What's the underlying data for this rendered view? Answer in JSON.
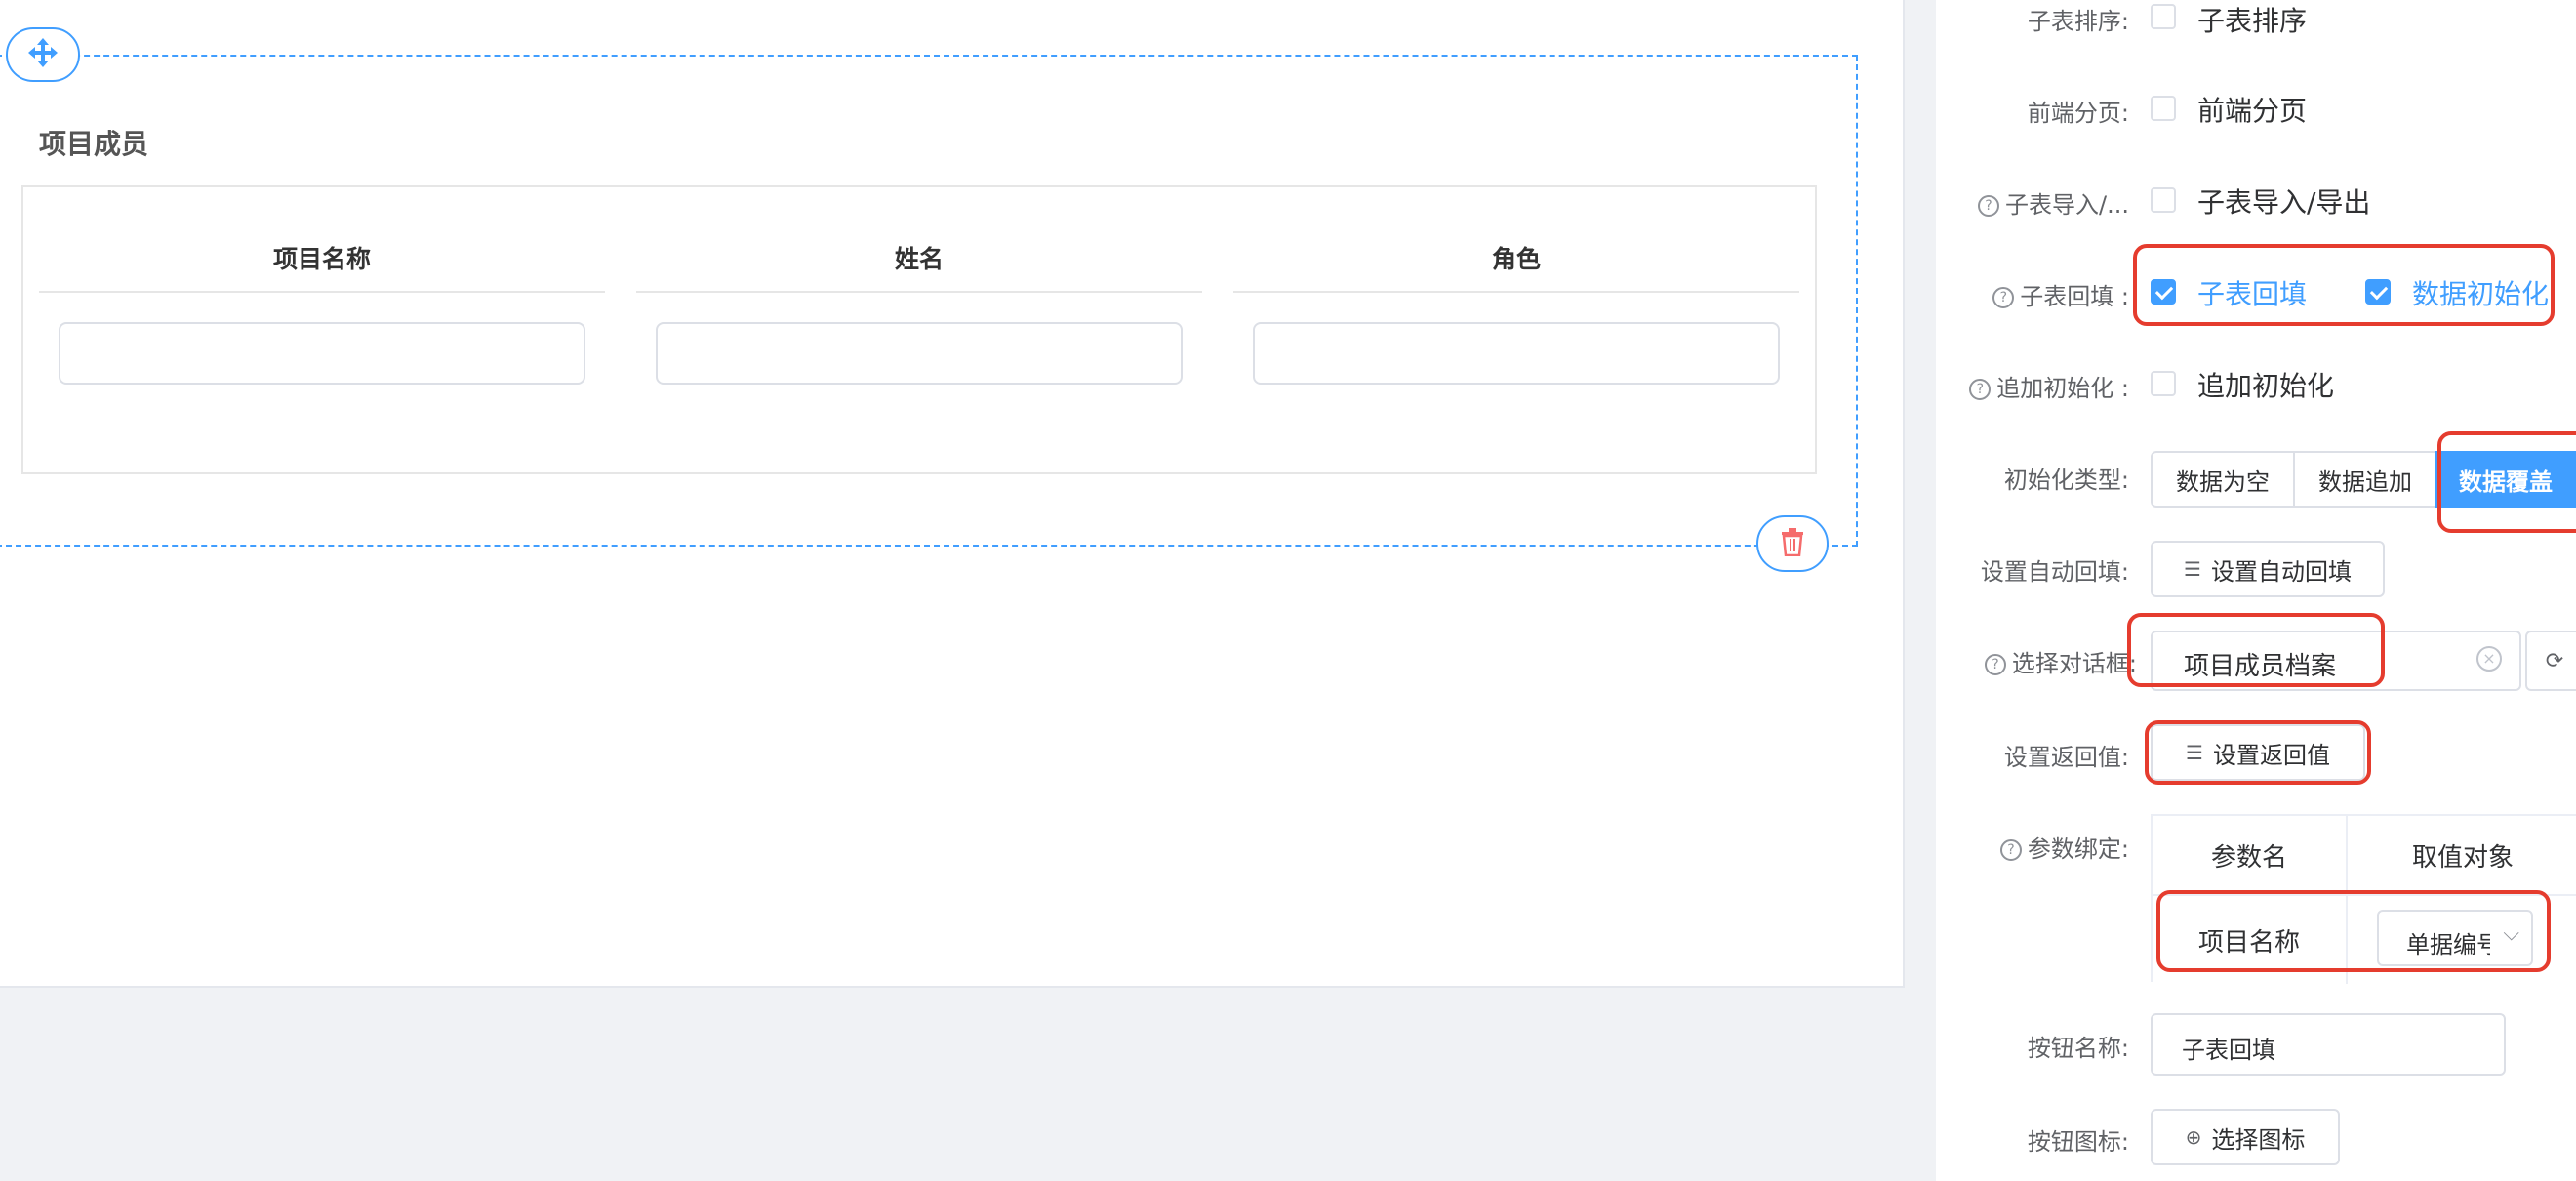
{
  "canvas": {
    "section_title": "项目成员",
    "columns": [
      "项目名称",
      "姓名",
      "角色"
    ]
  },
  "props": {
    "sort": {
      "label": "子表排序:",
      "option": "子表排序",
      "checked": false
    },
    "paging": {
      "label": "前端分页:",
      "option": "前端分页",
      "checked": false
    },
    "import_export": {
      "label": "子表导入/...",
      "option": "子表导入/导出",
      "checked": false
    },
    "backfill": {
      "label": "子表回填 :",
      "option1": "子表回填",
      "option2": "数据初始化",
      "checked1": true,
      "checked2": true
    },
    "append_init": {
      "label": "追加初始化 :",
      "option": "追加初始化",
      "checked": false
    },
    "init_type": {
      "label": "初始化类型:",
      "options": [
        "数据为空",
        "数据追加",
        "数据覆盖"
      ],
      "selected": "数据覆盖"
    },
    "auto_backfill": {
      "label": "设置自动回填:",
      "button": "设置自动回填"
    },
    "dialog": {
      "label": "选择对话框:",
      "value": "项目成员档案"
    },
    "return_value": {
      "label": "设置返回值:",
      "button": "设置返回值"
    },
    "param_binding": {
      "label": "参数绑定:",
      "headers": [
        "参数名",
        "取值对象"
      ],
      "rows": [
        {
          "name": "项目名称",
          "value": "单据编号"
        }
      ]
    },
    "button_name": {
      "label": "按钮名称:",
      "value": "子表回填"
    },
    "button_icon": {
      "label": "按钮图标:",
      "button": "选择图标"
    }
  },
  "colors": {
    "accent": "#409eff",
    "highlight": "#e53c2e",
    "delete": "#f56c6c"
  }
}
